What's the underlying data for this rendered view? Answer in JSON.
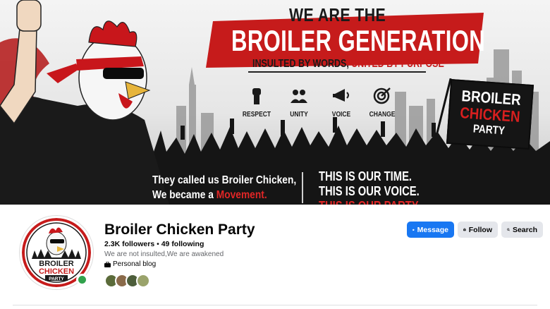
{
  "cover": {
    "headline_top": "WE ARE THE",
    "headline_main": "BROILER GENERATION",
    "tagline_prefix": "INSULTED BY WORDS, ",
    "tagline_red": "UNITED BY PURPOSE",
    "values": [
      {
        "label": "RESPECT",
        "icon": "raised-fist-icon"
      },
      {
        "label": "UNITY",
        "icon": "people-icon"
      },
      {
        "label": "VOICE",
        "icon": "megaphone-icon"
      },
      {
        "label": "CHANGE",
        "icon": "target-icon"
      }
    ],
    "flag": {
      "line1": "BROILER",
      "line2": "CHICKEN",
      "line3": "PARTY"
    },
    "caption_left_1": "They called us Broiler Chicken,",
    "caption_left_2_prefix": "We became a ",
    "caption_left_2_red": "Movement.",
    "caption_right_1": "THIS IS OUR TIME.",
    "caption_right_2": "THIS IS OUR VOICE.",
    "caption_right_3": "THIS IS OUR PARTY",
    "colors": {
      "accent_red": "#c61b1b",
      "dark": "#111111"
    }
  },
  "profile": {
    "name": "Broiler Chicken Party",
    "followers": "2.3K followers",
    "separator": " • ",
    "following": "49 following",
    "bio": "We are not insulted,We are awakened",
    "category": "Personal blog",
    "avatar_logo": {
      "line1": "BROILER",
      "line2": "CHICKEN",
      "line3": "PARTY"
    },
    "friend_colors": [
      "#5b6b3a",
      "#8a6a4a",
      "#4d5e3b",
      "#9aa36b"
    ]
  },
  "actions": {
    "message_label": "Message",
    "follow_label": "Follow",
    "search_label": "Search"
  },
  "colors": {
    "primary_blue": "#1877f2",
    "button_gray": "#e4e6eb",
    "online_green": "#31a24c"
  }
}
